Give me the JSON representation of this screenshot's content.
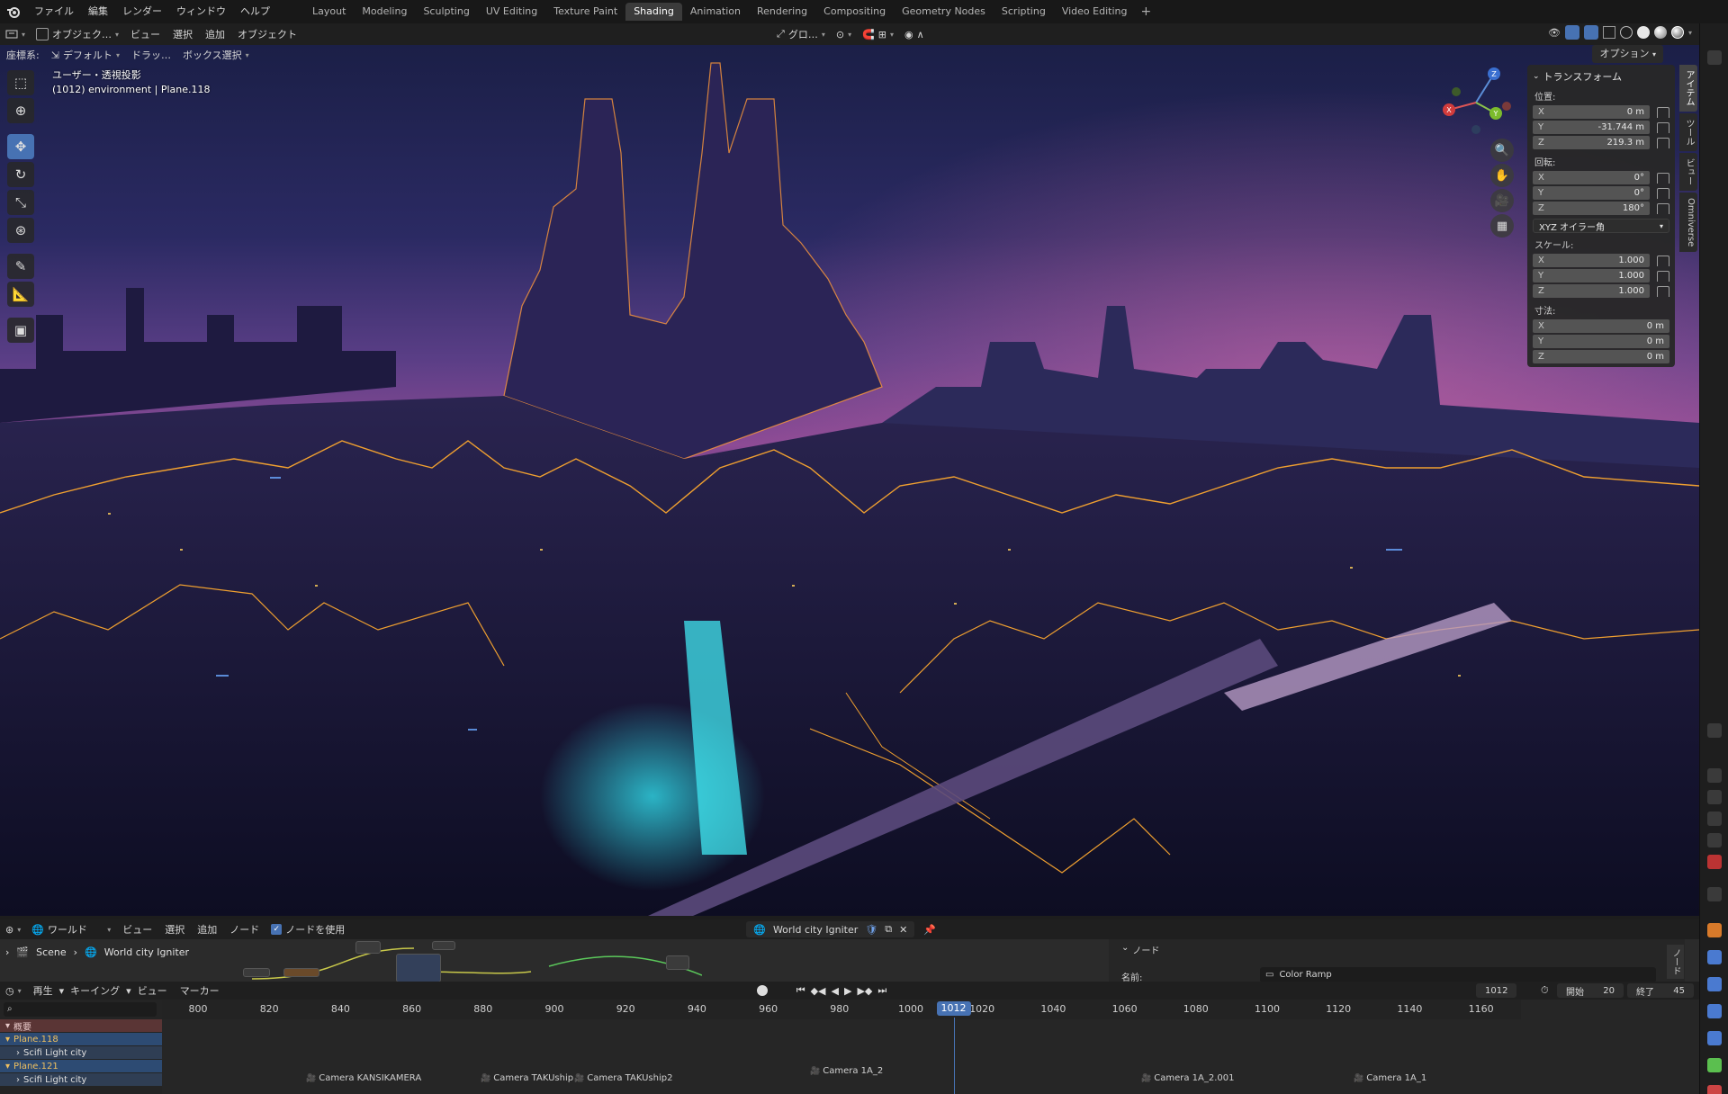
{
  "topbar": {
    "menus": [
      "ファイル",
      "編集",
      "レンダー",
      "ウィンドウ",
      "ヘルプ"
    ],
    "workspaces": [
      "Layout",
      "Modeling",
      "Sculpting",
      "UV Editing",
      "Texture Paint",
      "Shading",
      "Animation",
      "Rendering",
      "Compositing",
      "Geometry Nodes",
      "Scripting",
      "Video Editing"
    ],
    "active_workspace": "Shading",
    "add_tab": "+"
  },
  "viewport_header": {
    "mode": "オブジェク…",
    "menus": [
      "ビュー",
      "選択",
      "追加",
      "オブジェクト"
    ],
    "transform_orientation": "グロ…",
    "coord_label": "座標系:",
    "coord_value": "デフォルト",
    "drag_label": "ドラッ…",
    "select_mode": "ボックス選択",
    "options": "オプション"
  },
  "viewport": {
    "view_name": "ユーザー・透視投影",
    "object_info": "(1012) environment | Plane.118",
    "gizmo_axes": [
      "Z",
      "X",
      "Y"
    ]
  },
  "npanel": {
    "title": "トランスフォーム",
    "location_label": "位置:",
    "location": [
      [
        "X",
        "0 m"
      ],
      [
        "Y",
        "-31.744 m"
      ],
      [
        "Z",
        "219.3 m"
      ]
    ],
    "rotation_label": "回転:",
    "rotation": [
      [
        "X",
        "0°"
      ],
      [
        "Y",
        "0°"
      ],
      [
        "Z",
        "180°"
      ]
    ],
    "rotation_mode": "XYZ オイラー角",
    "scale_label": "スケール:",
    "scale": [
      [
        "X",
        "1.000"
      ],
      [
        "Y",
        "1.000"
      ],
      [
        "Z",
        "1.000"
      ]
    ],
    "dimensions_label": "寸法:",
    "dimensions": [
      [
        "X",
        "0 m"
      ],
      [
        "Y",
        "0 m"
      ],
      [
        "Z",
        "0 m"
      ]
    ],
    "tabs": [
      "アイテム",
      "ツール",
      "ビュー",
      "Omniverse"
    ]
  },
  "shader": {
    "type": "ワールド",
    "menus": [
      "ビュー",
      "選択",
      "追加",
      "ノード"
    ],
    "use_nodes": "ノードを使用",
    "world_name": "World city Igniter",
    "breadcrumb": [
      "Scene",
      "World city Igniter"
    ],
    "node_panel_title": "ノード",
    "name_label": "名前:",
    "name_value": "Color Ramp",
    "side_tab": "ノード"
  },
  "timeline": {
    "menus": [
      "再生",
      "キーイング",
      "ビュー",
      "マーカー"
    ],
    "current_frame": "1012",
    "start_label": "開始",
    "start": "20",
    "end_label": "終了",
    "end": "45",
    "ticks": [
      "800",
      "820",
      "840",
      "860",
      "880",
      "900",
      "920",
      "940",
      "960",
      "980",
      "1000",
      "1020",
      "1040",
      "1060",
      "1080",
      "1100",
      "1120",
      "1140",
      "1160"
    ],
    "channels": [
      {
        "label": "概要",
        "kind": "summary"
      },
      {
        "label": "Plane.118",
        "kind": "obj"
      },
      {
        "label": "Scifi Light city",
        "kind": "sub"
      },
      {
        "label": "Plane.121",
        "kind": "obj"
      },
      {
        "label": "Scifi Light city",
        "kind": "sub"
      }
    ],
    "markers": [
      "Camera KANSIKAMERA",
      "Camera TAKUship",
      "Camera TAKUship2",
      "Camera 1A_2",
      "Camera 1A_2.001",
      "Camera 1A_1"
    ]
  },
  "colors": {
    "accent": "#4772b3",
    "selection_outline": "#f0a030",
    "sky_top": "#1b1f47",
    "sky_glow": "#8d4b95"
  }
}
